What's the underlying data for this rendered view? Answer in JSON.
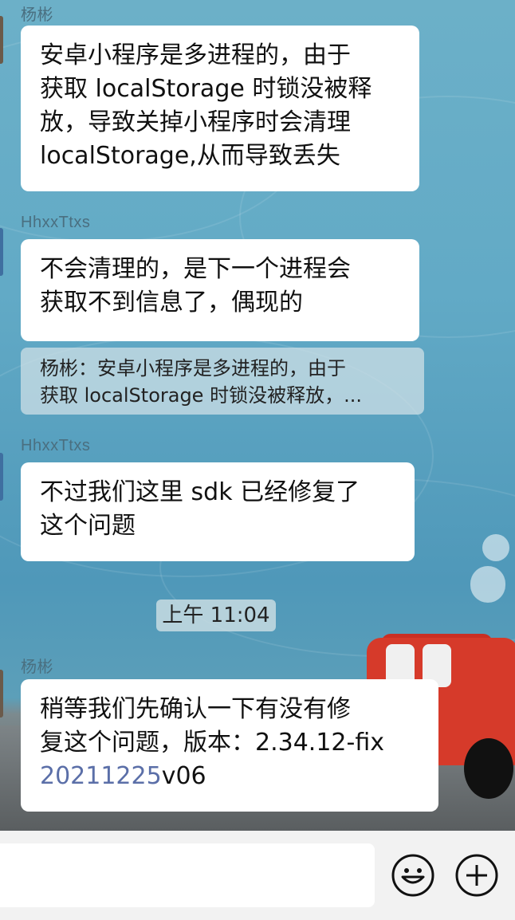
{
  "messages": [
    {
      "sender": "杨彬",
      "lines": [
        "安卓小程序是多进程的，由于",
        "获取 localStorage 时锁没被释",
        "放，导致关掉小程序时会清理",
        "localStorage,从而导致丢失"
      ]
    },
    {
      "sender": "HhxxTtxs",
      "lines": [
        "不会清理的，是下一个进程会",
        "获取不到信息了，偶现的"
      ]
    },
    {
      "sender": "HhxxTtxs",
      "lines": [
        "不过我们这里 sdk 已经修复了",
        "这个问题"
      ]
    },
    {
      "sender": "杨彬",
      "lines": [
        "稍等我们先确认一下有没有修",
        "复这个问题，版本：2.34.12-fix"
      ],
      "link_text": "20211225",
      "tail_text": "v06"
    }
  ],
  "quote": {
    "lines": [
      "杨彬：安卓小程序是多进程的，由于",
      "获取 localStorage 时锁没被释放，..."
    ]
  },
  "timestamp": "上午 11:04",
  "input_bar": {
    "emoji_icon": "emoji-icon",
    "plus_icon": "plus-icon"
  },
  "colors": {
    "link": "#5b6fa8",
    "bubble": "#ffffff",
    "sender_name": "#4a6f80"
  }
}
